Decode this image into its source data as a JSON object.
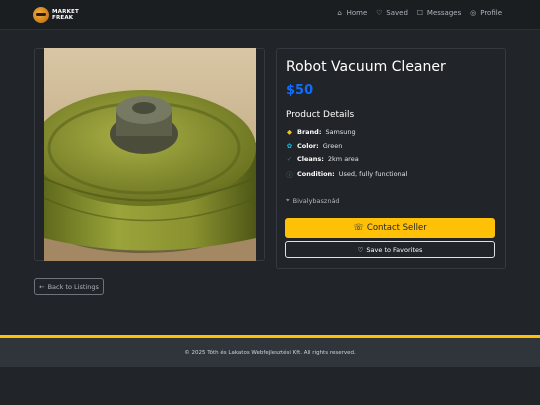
{
  "brand": {
    "logo_line1": "MARKET",
    "logo_line2": "FREAK"
  },
  "nav": {
    "items": [
      {
        "label": "Home",
        "icon": "house-icon",
        "glyph": "⌂"
      },
      {
        "label": "Saved",
        "icon": "heart-icon",
        "glyph": "♡"
      },
      {
        "label": "Messages",
        "icon": "chat-icon",
        "glyph": "☐"
      },
      {
        "label": "Profile",
        "icon": "person-circle-icon",
        "glyph": "◎"
      }
    ]
  },
  "product": {
    "title": "Robot Vacuum Cleaner",
    "price": "$50",
    "details_heading": "Product Details",
    "specs": [
      {
        "key": "Brand:",
        "value": "Samsung",
        "icon": "tag-icon",
        "glyph": "◆",
        "color": "#ffc107"
      },
      {
        "key": "Color:",
        "value": "Green",
        "icon": "palette-icon",
        "glyph": "✿",
        "color": "#0dcaf0"
      },
      {
        "key": "Cleans:",
        "value": "2km area",
        "icon": "check-circle-icon",
        "glyph": "✓",
        "color": "#198754"
      },
      {
        "key": "Condition:",
        "value": "Used, fully functional",
        "icon": "info-icon",
        "glyph": "ⓘ",
        "color": "#6c757d"
      }
    ],
    "location": "Bivalybasznád"
  },
  "actions": {
    "contact_label": "Contact Seller",
    "favorite_label": "Save to Favorites",
    "back_label": "Back to Listings"
  },
  "footer": {
    "text": "© 2025 Tóth és Lakatos Webfejlesztési Kft. All rights reserved."
  },
  "colors": {
    "accent": "#ffc107",
    "price": "#0d6efd",
    "background": "#212529"
  }
}
